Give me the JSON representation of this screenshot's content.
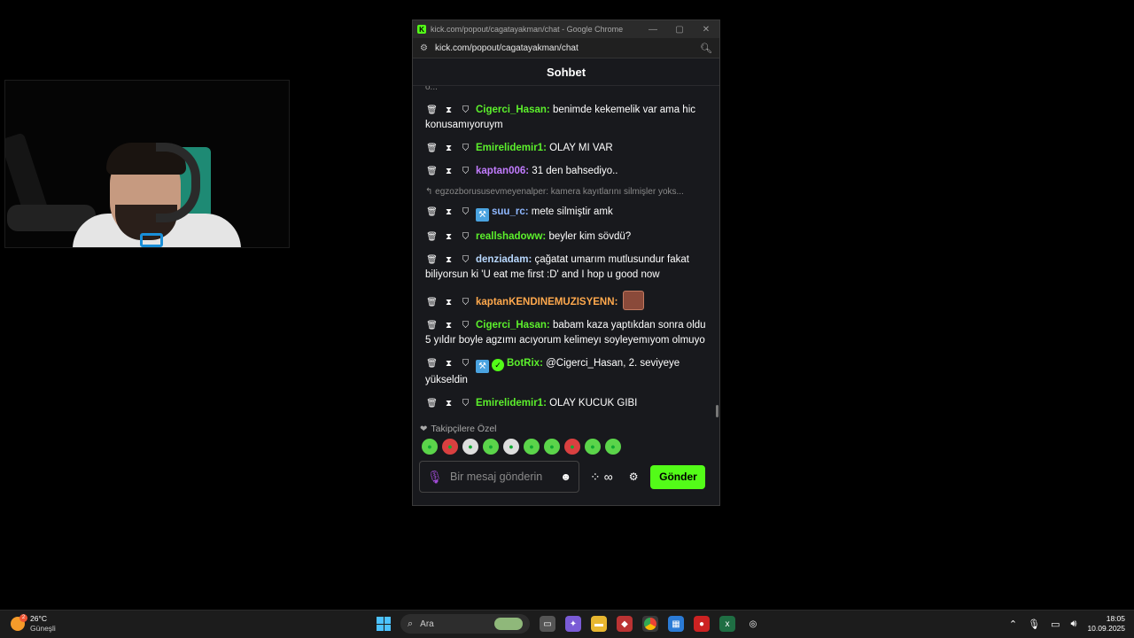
{
  "window": {
    "title": "kick.com/popout/cagatayakman/chat - Google Chrome",
    "url": "kick.com/popout/cagatayakman/chat",
    "controls": {
      "minimize": "—",
      "maximize": "▢",
      "close": "✕"
    }
  },
  "chat": {
    "header": "Sohbet",
    "cut_text": "o...",
    "messages": [
      {
        "user": "Cigerci_Hasan",
        "color": "#5cf02c",
        "text": "benimde kekemelik var ama hic konusamıyoruym"
      },
      {
        "user": "Emirelidemir1",
        "color": "#5cf02c",
        "text": "OLAY MI VAR"
      },
      {
        "user": "kaptan006",
        "color": "#c27cff",
        "text": "31 den bahsediyo.."
      },
      {
        "reply": "egzozborususevmeyenalper: kamera kayıtlarını silmişler yoks..."
      },
      {
        "user": "suu_rc",
        "color": "#8fb8ff",
        "text": "mete silmiştir amk",
        "badge": "blue"
      },
      {
        "user": "reallshadoww",
        "color": "#5cf02c",
        "text": "beyler kim sövdü?"
      },
      {
        "user": "denziadam",
        "color": "#b8d8ff",
        "text": "çağatat umarım mutlusundur fakat biliyorsun ki 'U eat me first :D' and I hop u good now"
      },
      {
        "user": "kaptanKENDINEMUZISYENN",
        "color": "#ffa94d",
        "text": "",
        "emote": true
      },
      {
        "user": "Cigerci_Hasan",
        "color": "#5cf02c",
        "text": "babam kaza yaptıkdan sonra oldu 5 yıldır boyle agzımı acıyorum kelimeyı soyleyemıyom olmuyo"
      },
      {
        "user": "BotRix",
        "color": "#5cf02c",
        "text": "@Cigerci_Hasan, 2. seviyeye yükseldin",
        "badge": "blue",
        "verified": true
      },
      {
        "user": "Emirelidemir1",
        "color": "#5cf02c",
        "text": "OLAY KUCUK GIBI"
      }
    ],
    "followers_label": "Takipçilere Özel",
    "input_placeholder": "Bir mesaj gönderin",
    "send_label": "Gönder"
  },
  "taskbar": {
    "weather_temp": "26°C",
    "weather_desc": "Güneşli",
    "weather_badge": "2",
    "search_label": "Ara",
    "time": "18:05",
    "date": "10.09.2025"
  }
}
